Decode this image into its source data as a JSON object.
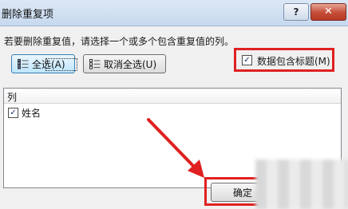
{
  "window": {
    "title": "删除重复项",
    "help_label": "?",
    "close_label": "✕"
  },
  "instruction": "若要删除重复值，请选择一个或多个包含重复值的列。",
  "buttons": {
    "select_all": "全选(A)",
    "deselect_all": "取消全选(U)",
    "ok": "确定"
  },
  "header_option": {
    "label": "数据包含标题(M)",
    "checked": true
  },
  "columns": {
    "header": "列",
    "items": [
      {
        "label": "姓名",
        "checked": true
      }
    ]
  },
  "colors": {
    "highlight": "#e02020",
    "arrow": "#e02020"
  }
}
